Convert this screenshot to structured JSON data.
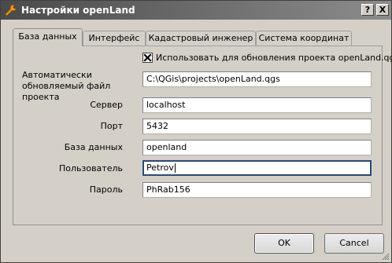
{
  "window": {
    "title": "Настройки openLand",
    "help_label": "?",
    "close_label": "X"
  },
  "tabs": [
    {
      "label": "База данных",
      "active": true
    },
    {
      "label": "Интерфейс",
      "active": false
    },
    {
      "label": "Кадастровый инженер",
      "active": false
    },
    {
      "label": "Система координат",
      "active": false
    }
  ],
  "form": {
    "autoupdate_checkbox": {
      "label": "Использовать для обновления проекта openLand.qgs",
      "checked": true
    },
    "project_file": {
      "label": "Автоматически обновляемый файл проекта",
      "value": "C:\\QGis\\projects\\openLand.qgs"
    },
    "server": {
      "label": "Сервер",
      "value": "localhost"
    },
    "port": {
      "label": "Порт",
      "value": "5432"
    },
    "database": {
      "label": "База данных",
      "value": "openland"
    },
    "user": {
      "label": "Пользователь",
      "value": "Petrov"
    },
    "password": {
      "label": "Пароль",
      "value": "PhRab156"
    }
  },
  "buttons": {
    "ok": "OK",
    "cancel": "Cancel"
  },
  "icons": {
    "app": "wrench-icon",
    "help": "help-icon",
    "close": "close-icon",
    "check": "check-x-icon",
    "resize": "resize-grip-icon"
  }
}
